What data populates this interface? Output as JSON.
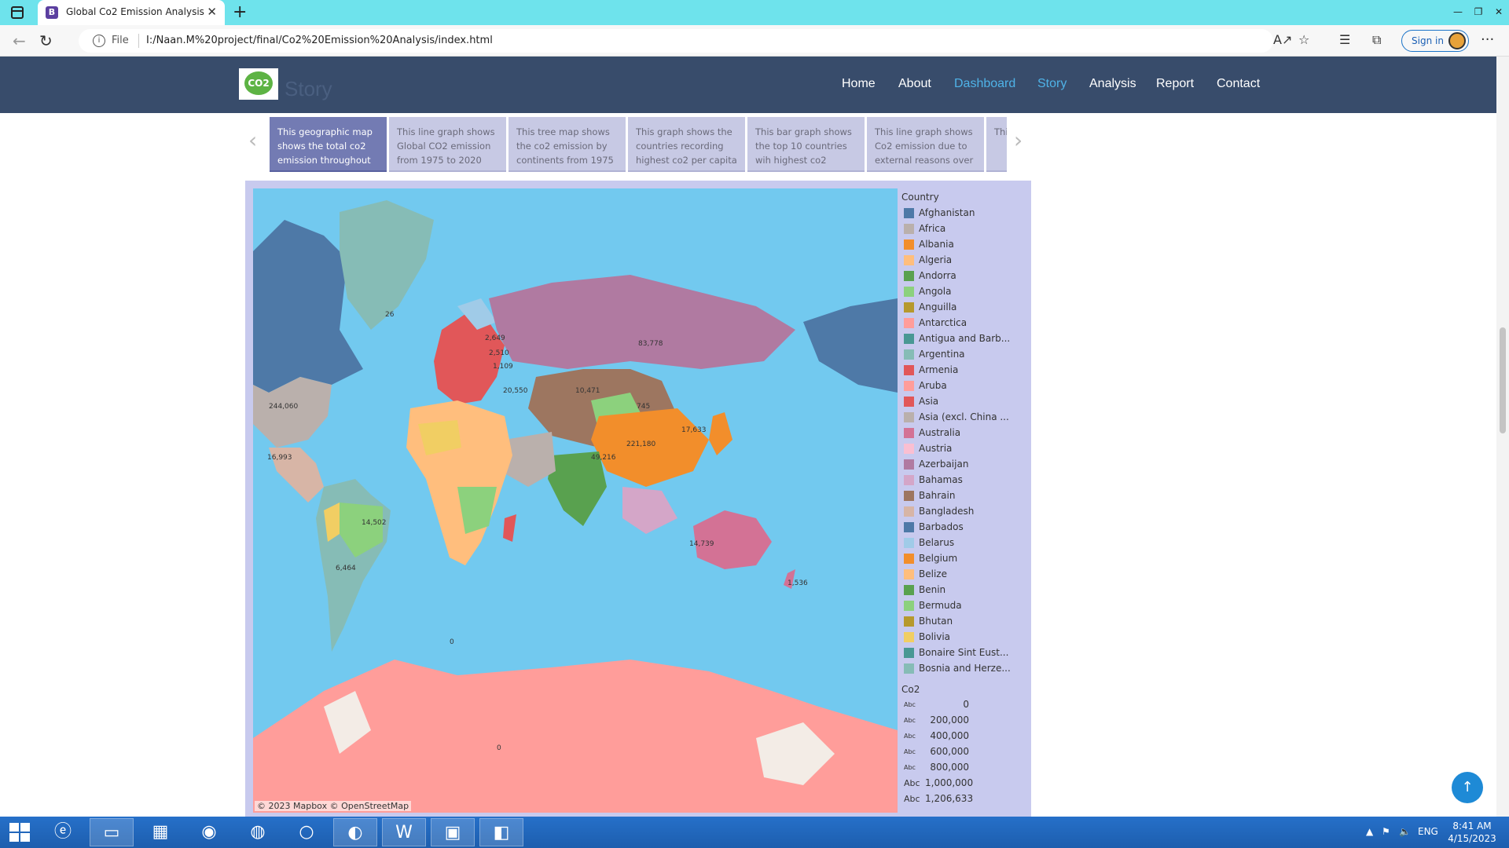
{
  "browser": {
    "tab_title": "Global Co2 Emission Analysis",
    "tab_favicon": "B",
    "file_label": "File",
    "url": "I:/Naan.M%20project/final/Co2%20Emission%20Analysis/index.html",
    "signin_label": "Sign in"
  },
  "site": {
    "logo_text": "CO2",
    "brand": "Story",
    "nav": [
      "Home",
      "About",
      "Dashboard",
      "Story",
      "Analysis",
      "Report",
      "Contact"
    ]
  },
  "story_points": [
    "This geographic map shows the total co2 emission throughout",
    "This line graph shows Global CO2 emission from 1975 to 2020",
    "This tree map shows the co2 emission by continents from 1975",
    "This graph shows the countries recording highest co2 per capita",
    "This bar graph shows the top 10 countries wih highest co2",
    "This line graph shows Co2 emission due to external reasons over",
    "This the to"
  ],
  "map": {
    "attribution": "© 2023 Mapbox  © OpenStreetMap",
    "labels": [
      "83,778",
      "26",
      "244,060",
      "221,180",
      "14,739",
      "14,502",
      "10,471",
      "745",
      "16,993",
      "49,216",
      "17,633",
      "2,649",
      "2,510",
      "1,109",
      "20,550",
      "6,464",
      "1,536",
      "0",
      "0"
    ]
  },
  "legend": {
    "title": "Country",
    "items": [
      {
        "label": "Afghanistan",
        "color": "#4e79a7"
      },
      {
        "label": "Africa",
        "color": "#bab0ac"
      },
      {
        "label": "Albania",
        "color": "#f28e2b"
      },
      {
        "label": "Algeria",
        "color": "#ffbe7d"
      },
      {
        "label": "Andorra",
        "color": "#59a14f"
      },
      {
        "label": "Angola",
        "color": "#8cd17d"
      },
      {
        "label": "Anguilla",
        "color": "#b6992d"
      },
      {
        "label": "Antarctica",
        "color": "#ff9d9a"
      },
      {
        "label": "Antigua and Barb...",
        "color": "#499894"
      },
      {
        "label": "Argentina",
        "color": "#86bcb6"
      },
      {
        "label": "Armenia",
        "color": "#e15759"
      },
      {
        "label": "Aruba",
        "color": "#ff9d9a"
      },
      {
        "label": "Asia",
        "color": "#e15759"
      },
      {
        "label": "Asia (excl. China ...",
        "color": "#bab0ac"
      },
      {
        "label": "Australia",
        "color": "#d37295"
      },
      {
        "label": "Austria",
        "color": "#fabfd2"
      },
      {
        "label": "Azerbaijan",
        "color": "#b07aa1"
      },
      {
        "label": "Bahamas",
        "color": "#d4a6c8"
      },
      {
        "label": "Bahrain",
        "color": "#9d7660"
      },
      {
        "label": "Bangladesh",
        "color": "#d7b5a6"
      },
      {
        "label": "Barbados",
        "color": "#4e79a7"
      },
      {
        "label": "Belarus",
        "color": "#a0cbe8"
      },
      {
        "label": "Belgium",
        "color": "#f28e2b"
      },
      {
        "label": "Belize",
        "color": "#ffbe7d"
      },
      {
        "label": "Benin",
        "color": "#59a14f"
      },
      {
        "label": "Bermuda",
        "color": "#8cd17d"
      },
      {
        "label": "Bhutan",
        "color": "#b6992d"
      },
      {
        "label": "Bolivia",
        "color": "#f1ce63"
      },
      {
        "label": "Bonaire Sint Eust...",
        "color": "#499894"
      },
      {
        "label": "Bosnia and Herze...",
        "color": "#86bcb6"
      }
    ]
  },
  "co2_legend": {
    "title": "Co2",
    "abc": "Abc",
    "items": [
      "0",
      "200,000",
      "400,000",
      "600,000",
      "800,000",
      "1,000,000",
      "1,206,633"
    ]
  },
  "taskbar": {
    "language": "ENG",
    "time": "8:41 AM",
    "date": "4/15/2023"
  }
}
